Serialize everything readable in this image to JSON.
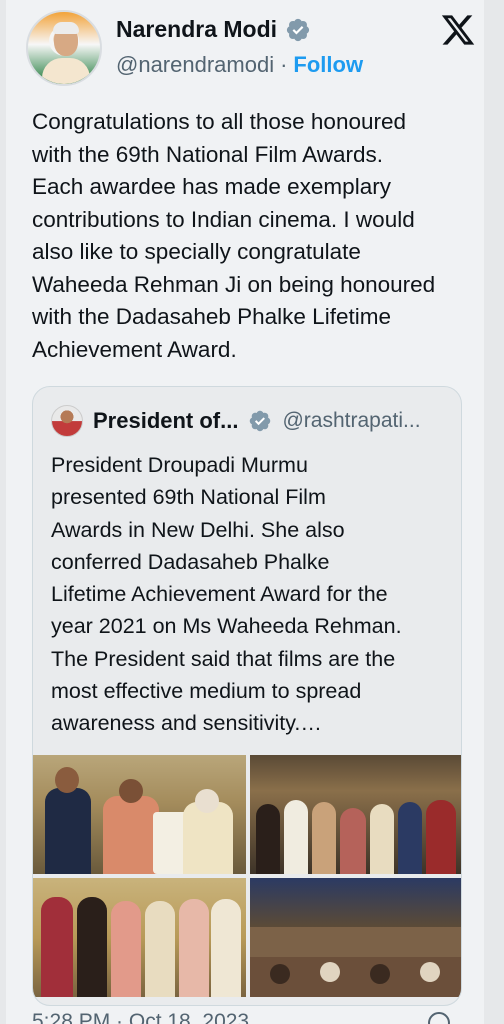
{
  "author": {
    "name": "Narendra Modi",
    "handle": "@narendramodi",
    "separator": "·",
    "follow_label": "Follow"
  },
  "tweet": {
    "text": "Congratulations to all those honoured\nwith the 69th National Film Awards.\nEach awardee has made exemplary\ncontributions to Indian cinema. I would\nalso like to specially congratulate\nWaheeda Rehman Ji on being honoured\nwith the Dadasaheb Phalke Lifetime\nAchievement Award."
  },
  "quote": {
    "name": "President of...",
    "handle": "@rashtrapati...",
    "text": "President Droupadi Murmu\npresented 69th National Film\nAwards in New Delhi. She also\nconferred Dadasaheb Phalke\nLifetime Achievement Award for the\nyear 2021 on Ms Waheeda Rehman.\nThe President said that films are the\nmost effective medium to spread\nawareness and sensitivity.…"
  },
  "footer": {
    "timestamp": "5:28 PM · Oct 18, 2023"
  },
  "icons": {
    "verified": "verified-badge-icon",
    "x_logo": "x-logo-icon",
    "info": "info-icon"
  },
  "colors": {
    "accent": "#1d9bf0",
    "verified": "#829aab",
    "muted": "#536471",
    "text": "#0f1419"
  }
}
